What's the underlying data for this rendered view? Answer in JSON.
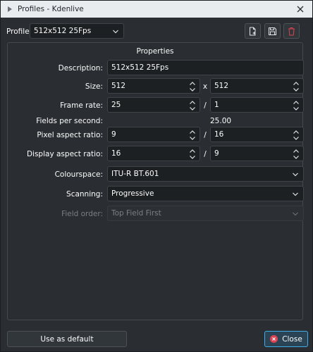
{
  "window": {
    "title": "Profiles - Kdenlive"
  },
  "profile": {
    "label": "Profile:",
    "selected": "512x512 25Fps"
  },
  "toolbar": {
    "new_icon": "new-profile-icon",
    "save_icon": "save-icon",
    "delete_icon": "delete-icon"
  },
  "properties": {
    "title": "Properties",
    "description_label": "Description:",
    "description_value": "512x512 25Fps",
    "size_label": "Size:",
    "width": "512",
    "size_sep": "x",
    "height": "512",
    "frame_rate_label": "Frame rate:",
    "fps_num": "25",
    "fps_sep": "/",
    "fps_den": "1",
    "fields_label": "Fields per second:",
    "fields_value": "25.00",
    "par_label": "Pixel aspect ratio:",
    "par_num": "9",
    "par_sep": "/",
    "par_den": "16",
    "dar_label": "Display aspect ratio:",
    "dar_num": "16",
    "dar_sep": "/",
    "dar_den": "9",
    "colourspace_label": "Colourspace:",
    "colourspace_value": "ITU-R BT.601",
    "scanning_label": "Scanning:",
    "scanning_value": "Progressive",
    "field_order_label": "Field order:",
    "field_order_value": "Top Field First"
  },
  "buttons": {
    "use_default": "Use as default",
    "close": "Close"
  },
  "colors": {
    "accent": "#3daee9",
    "danger": "#da4453",
    "background": "#2a2e32"
  }
}
